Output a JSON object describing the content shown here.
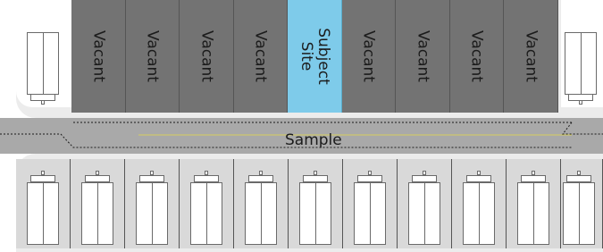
{
  "top_lots": [
    {
      "label": "Vacant",
      "type": "vacant"
    },
    {
      "label": "Vacant",
      "type": "vacant"
    },
    {
      "label": "Vacant",
      "type": "vacant"
    },
    {
      "label": "Vacant",
      "type": "vacant"
    },
    {
      "label": "Subject\nSite",
      "type": "subject"
    },
    {
      "label": "Vacant",
      "type": "vacant"
    },
    {
      "label": "Vacant",
      "type": "vacant"
    },
    {
      "label": "Vacant",
      "type": "vacant"
    },
    {
      "label": "Vacant",
      "type": "vacant"
    }
  ],
  "road": {
    "label": "Sample"
  },
  "colors": {
    "vacant": "#737373",
    "subject": "#7ecbea",
    "road": "#a9a9a9",
    "block": "#ececec",
    "centre_line": "#d8d060"
  }
}
